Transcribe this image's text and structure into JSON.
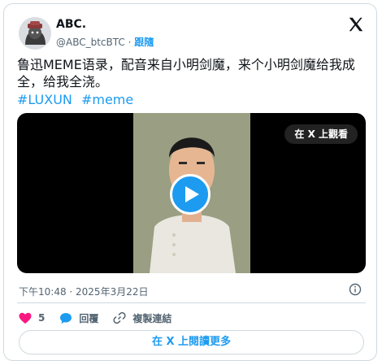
{
  "author": {
    "name": "ABC.",
    "handle": "@ABC_btcBTC",
    "separator": "·",
    "follow_label": "跟隨"
  },
  "tweet": {
    "text": "鲁迅MEME语录，配音来自小明剑魔，来个小明剑魔给我成全，给我全浇。",
    "hashtags": [
      "#LUXUN",
      "#meme"
    ],
    "timestamp": "下午10:48 · 2025年3月22日"
  },
  "media": {
    "watch_label": "在 X 上觀看"
  },
  "actions": {
    "like_count": "5",
    "reply_label": "回覆",
    "copy_link_label": "複製連結"
  },
  "more_label": "在 X 上閱讀更多",
  "colors": {
    "accent": "#1d9bf0",
    "like": "#f91880",
    "muted": "#536471"
  }
}
